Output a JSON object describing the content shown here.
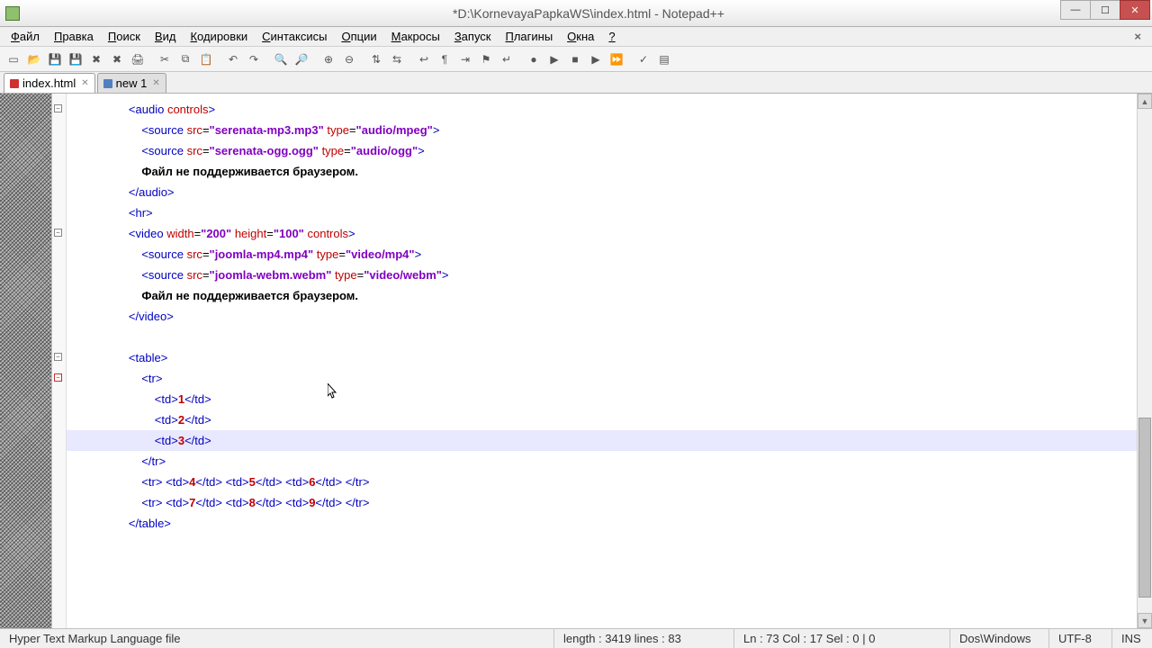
{
  "title": "*D:\\KornevayaPapkaWS\\index.html - Notepad++",
  "menu": [
    "Файл",
    "Правка",
    "Поиск",
    "Вид",
    "Кодировки",
    "Синтаксисы",
    "Опции",
    "Макросы",
    "Запуск",
    "Плагины",
    "Окна",
    "?"
  ],
  "tabs": [
    {
      "label": "index.html",
      "modified": true,
      "active": true
    },
    {
      "label": "new 1",
      "modified": false,
      "active": false
    }
  ],
  "status": {
    "filetype": "Hyper Text Markup Language file",
    "length": "length : 3419    lines : 83",
    "pos": "Ln : 73    Col : 17    Sel : 0 | 0",
    "eol": "Dos\\Windows",
    "enc": "UTF-8",
    "ins": "INS"
  },
  "code_lines": [
    {
      "ind": 2,
      "seg": [
        {
          "c": "t-tag",
          "t": "<audio"
        },
        {
          "c": "t-plain",
          "t": " "
        },
        {
          "c": "t-attr",
          "t": "controls"
        },
        {
          "c": "t-tag",
          "t": ">"
        }
      ]
    },
    {
      "ind": 3,
      "seg": [
        {
          "c": "t-tag",
          "t": "<source"
        },
        {
          "c": "t-plain",
          "t": " "
        },
        {
          "c": "t-attr",
          "t": "src"
        },
        {
          "c": "t-plain",
          "t": "="
        },
        {
          "c": "t-str",
          "t": "\"serenata-mp3.mp3\""
        },
        {
          "c": "t-plain",
          "t": " "
        },
        {
          "c": "t-attr",
          "t": "type"
        },
        {
          "c": "t-plain",
          "t": "="
        },
        {
          "c": "t-str",
          "t": "\"audio/mpeg\""
        },
        {
          "c": "t-tag",
          "t": ">"
        }
      ]
    },
    {
      "ind": 3,
      "seg": [
        {
          "c": "t-tag",
          "t": "<source"
        },
        {
          "c": "t-plain",
          "t": " "
        },
        {
          "c": "t-attr",
          "t": "src"
        },
        {
          "c": "t-plain",
          "t": "="
        },
        {
          "c": "t-str",
          "t": "\"serenata-ogg.ogg\""
        },
        {
          "c": "t-plain",
          "t": " "
        },
        {
          "c": "t-attr",
          "t": "type"
        },
        {
          "c": "t-plain",
          "t": "="
        },
        {
          "c": "t-str",
          "t": "\"audio/ogg\""
        },
        {
          "c": "t-tag",
          "t": ">"
        }
      ]
    },
    {
      "ind": 3,
      "seg": [
        {
          "c": "t-txt",
          "t": "Файл не поддерживается браузером."
        }
      ]
    },
    {
      "ind": 2,
      "seg": [
        {
          "c": "t-tag",
          "t": "</audio>"
        }
      ]
    },
    {
      "ind": 2,
      "seg": [
        {
          "c": "t-tag",
          "t": "<hr>"
        }
      ]
    },
    {
      "ind": 2,
      "seg": [
        {
          "c": "t-tag",
          "t": "<video"
        },
        {
          "c": "t-plain",
          "t": " "
        },
        {
          "c": "t-attr",
          "t": "width"
        },
        {
          "c": "t-plain",
          "t": "="
        },
        {
          "c": "t-str",
          "t": "\"200\""
        },
        {
          "c": "t-plain",
          "t": " "
        },
        {
          "c": "t-attr",
          "t": "height"
        },
        {
          "c": "t-plain",
          "t": "="
        },
        {
          "c": "t-str",
          "t": "\"100\""
        },
        {
          "c": "t-plain",
          "t": " "
        },
        {
          "c": "t-attr",
          "t": "controls"
        },
        {
          "c": "t-tag",
          "t": ">"
        }
      ]
    },
    {
      "ind": 3,
      "seg": [
        {
          "c": "t-tag",
          "t": "<source"
        },
        {
          "c": "t-plain",
          "t": " "
        },
        {
          "c": "t-attr",
          "t": "src"
        },
        {
          "c": "t-plain",
          "t": "="
        },
        {
          "c": "t-str",
          "t": "\"joomla-mp4.mp4\""
        },
        {
          "c": "t-plain",
          "t": " "
        },
        {
          "c": "t-attr",
          "t": "type"
        },
        {
          "c": "t-plain",
          "t": "="
        },
        {
          "c": "t-str",
          "t": "\"video/mp4\""
        },
        {
          "c": "t-tag",
          "t": ">"
        }
      ]
    },
    {
      "ind": 3,
      "seg": [
        {
          "c": "t-tag",
          "t": "<source"
        },
        {
          "c": "t-plain",
          "t": " "
        },
        {
          "c": "t-attr",
          "t": "src"
        },
        {
          "c": "t-plain",
          "t": "="
        },
        {
          "c": "t-str",
          "t": "\"joomla-webm.webm\""
        },
        {
          "c": "t-plain",
          "t": " "
        },
        {
          "c": "t-attr",
          "t": "type"
        },
        {
          "c": "t-plain",
          "t": "="
        },
        {
          "c": "t-str",
          "t": "\"video/webm\""
        },
        {
          "c": "t-tag",
          "t": ">"
        }
      ]
    },
    {
      "ind": 3,
      "seg": [
        {
          "c": "t-txt",
          "t": "Файл не поддерживается браузером."
        }
      ]
    },
    {
      "ind": 2,
      "seg": [
        {
          "c": "t-tag",
          "t": "</video>"
        }
      ]
    },
    {
      "ind": 2,
      "seg": []
    },
    {
      "ind": 2,
      "seg": [
        {
          "c": "t-tag",
          "t": "<table>"
        }
      ]
    },
    {
      "ind": 3,
      "seg": [
        {
          "c": "t-tag",
          "t": "<tr>"
        }
      ]
    },
    {
      "ind": 4,
      "seg": [
        {
          "c": "t-tag",
          "t": "<td>"
        },
        {
          "c": "t-num",
          "t": "1"
        },
        {
          "c": "t-tag",
          "t": "</td>"
        }
      ]
    },
    {
      "ind": 4,
      "seg": [
        {
          "c": "t-tag",
          "t": "<td>"
        },
        {
          "c": "t-num",
          "t": "2"
        },
        {
          "c": "t-tag",
          "t": "</td>"
        }
      ]
    },
    {
      "ind": 4,
      "seg": [
        {
          "c": "t-tag",
          "t": "<td>"
        },
        {
          "c": "t-num",
          "t": "3"
        },
        {
          "c": "t-tag",
          "t": "</td>"
        }
      ]
    },
    {
      "ind": 3,
      "seg": [
        {
          "c": "t-tag",
          "t": "</tr>"
        }
      ]
    },
    {
      "ind": 3,
      "seg": [
        {
          "c": "t-tag",
          "t": "<tr>"
        },
        {
          "c": "t-plain",
          "t": " "
        },
        {
          "c": "t-tag",
          "t": "<td>"
        },
        {
          "c": "t-num",
          "t": "4"
        },
        {
          "c": "t-tag",
          "t": "</td>"
        },
        {
          "c": "t-plain",
          "t": " "
        },
        {
          "c": "t-tag",
          "t": "<td>"
        },
        {
          "c": "t-num",
          "t": "5"
        },
        {
          "c": "t-tag",
          "t": "</td>"
        },
        {
          "c": "t-plain",
          "t": " "
        },
        {
          "c": "t-tag",
          "t": "<td>"
        },
        {
          "c": "t-num",
          "t": "6"
        },
        {
          "c": "t-tag",
          "t": "</td>"
        },
        {
          "c": "t-plain",
          "t": " "
        },
        {
          "c": "t-tag",
          "t": "</tr>"
        }
      ]
    },
    {
      "ind": 3,
      "seg": [
        {
          "c": "t-tag",
          "t": "<tr>"
        },
        {
          "c": "t-plain",
          "t": " "
        },
        {
          "c": "t-tag",
          "t": "<td>"
        },
        {
          "c": "t-num",
          "t": "7"
        },
        {
          "c": "t-tag",
          "t": "</td>"
        },
        {
          "c": "t-plain",
          "t": " "
        },
        {
          "c": "t-tag",
          "t": "<td>"
        },
        {
          "c": "t-num",
          "t": "8"
        },
        {
          "c": "t-tag",
          "t": "</td>"
        },
        {
          "c": "t-plain",
          "t": " "
        },
        {
          "c": "t-tag",
          "t": "<td>"
        },
        {
          "c": "t-num",
          "t": "9"
        },
        {
          "c": "t-tag",
          "t": "</td>"
        },
        {
          "c": "t-plain",
          "t": " "
        },
        {
          "c": "t-tag",
          "t": "</tr>"
        }
      ]
    },
    {
      "ind": 2,
      "seg": [
        {
          "c": "t-tag",
          "t": "</table>"
        }
      ]
    }
  ],
  "highlight_line_index": 16,
  "fold_marks": [
    0,
    6,
    12,
    13
  ],
  "toolbar_icons": [
    "new",
    "open",
    "save",
    "saveall",
    "close",
    "closeall",
    "print",
    "",
    "cut",
    "copy",
    "paste",
    "",
    "undo",
    "redo",
    "",
    "find",
    "replace",
    "",
    "zoom-in",
    "zoom-out",
    "",
    "sync-v",
    "sync-h",
    "",
    "wrap",
    "allchars",
    "indent",
    "lang",
    "eol",
    "",
    "rec",
    "play",
    "stop",
    "play1",
    "playn",
    "",
    "spell",
    "doc"
  ]
}
